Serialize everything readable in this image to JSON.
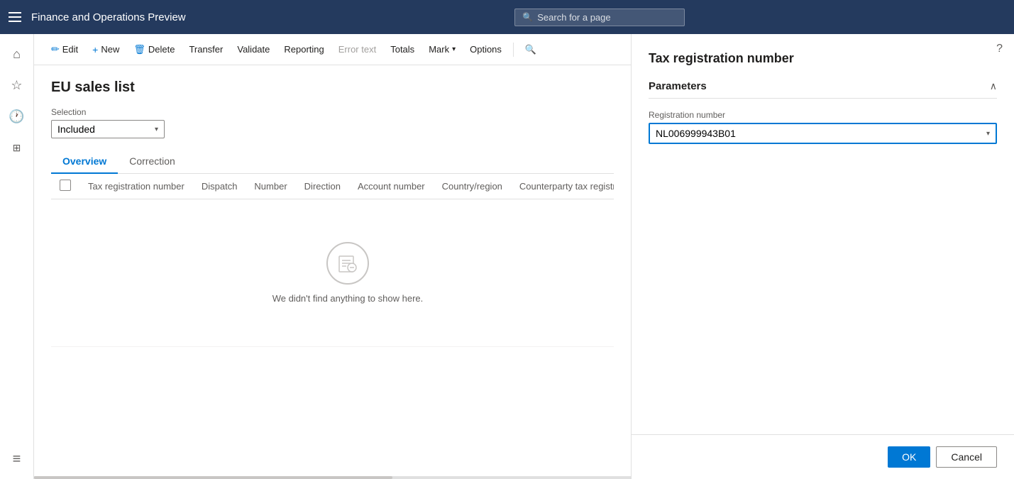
{
  "app": {
    "title": "Finance and Operations Preview",
    "search_placeholder": "Search for a page"
  },
  "action_bar": {
    "edit_label": "Edit",
    "new_label": "New",
    "delete_label": "Delete",
    "transfer_label": "Transfer",
    "validate_label": "Validate",
    "reporting_label": "Reporting",
    "error_text_label": "Error text",
    "totals_label": "Totals",
    "mark_label": "Mark",
    "options_label": "Options"
  },
  "page": {
    "title": "EU sales list",
    "selection_label": "Selection",
    "selection_value": "Included"
  },
  "tabs": [
    {
      "label": "Overview",
      "active": true
    },
    {
      "label": "Correction",
      "active": false
    }
  ],
  "table": {
    "columns": [
      {
        "label": ""
      },
      {
        "label": "Tax registration number"
      },
      {
        "label": "Dispatch"
      },
      {
        "label": "Number"
      },
      {
        "label": "Direction"
      },
      {
        "label": "Account number"
      },
      {
        "label": "Country/region"
      },
      {
        "label": "Counterparty tax registration"
      }
    ],
    "empty_message": "We didn't find anything to show here."
  },
  "right_panel": {
    "title": "Tax registration number",
    "help_icon": "?",
    "parameters_label": "Parameters",
    "registration_number_label": "Registration number",
    "registration_number_value": "NL006999943B01",
    "ok_label": "OK",
    "cancel_label": "Cancel"
  },
  "sidebar": {
    "icons": [
      {
        "name": "home-icon",
        "symbol": "⌂"
      },
      {
        "name": "favorites-icon",
        "symbol": "☆"
      },
      {
        "name": "recent-icon",
        "symbol": "🕐"
      },
      {
        "name": "workspaces-icon",
        "symbol": "⊞"
      },
      {
        "name": "modules-icon",
        "symbol": "≡"
      }
    ]
  }
}
